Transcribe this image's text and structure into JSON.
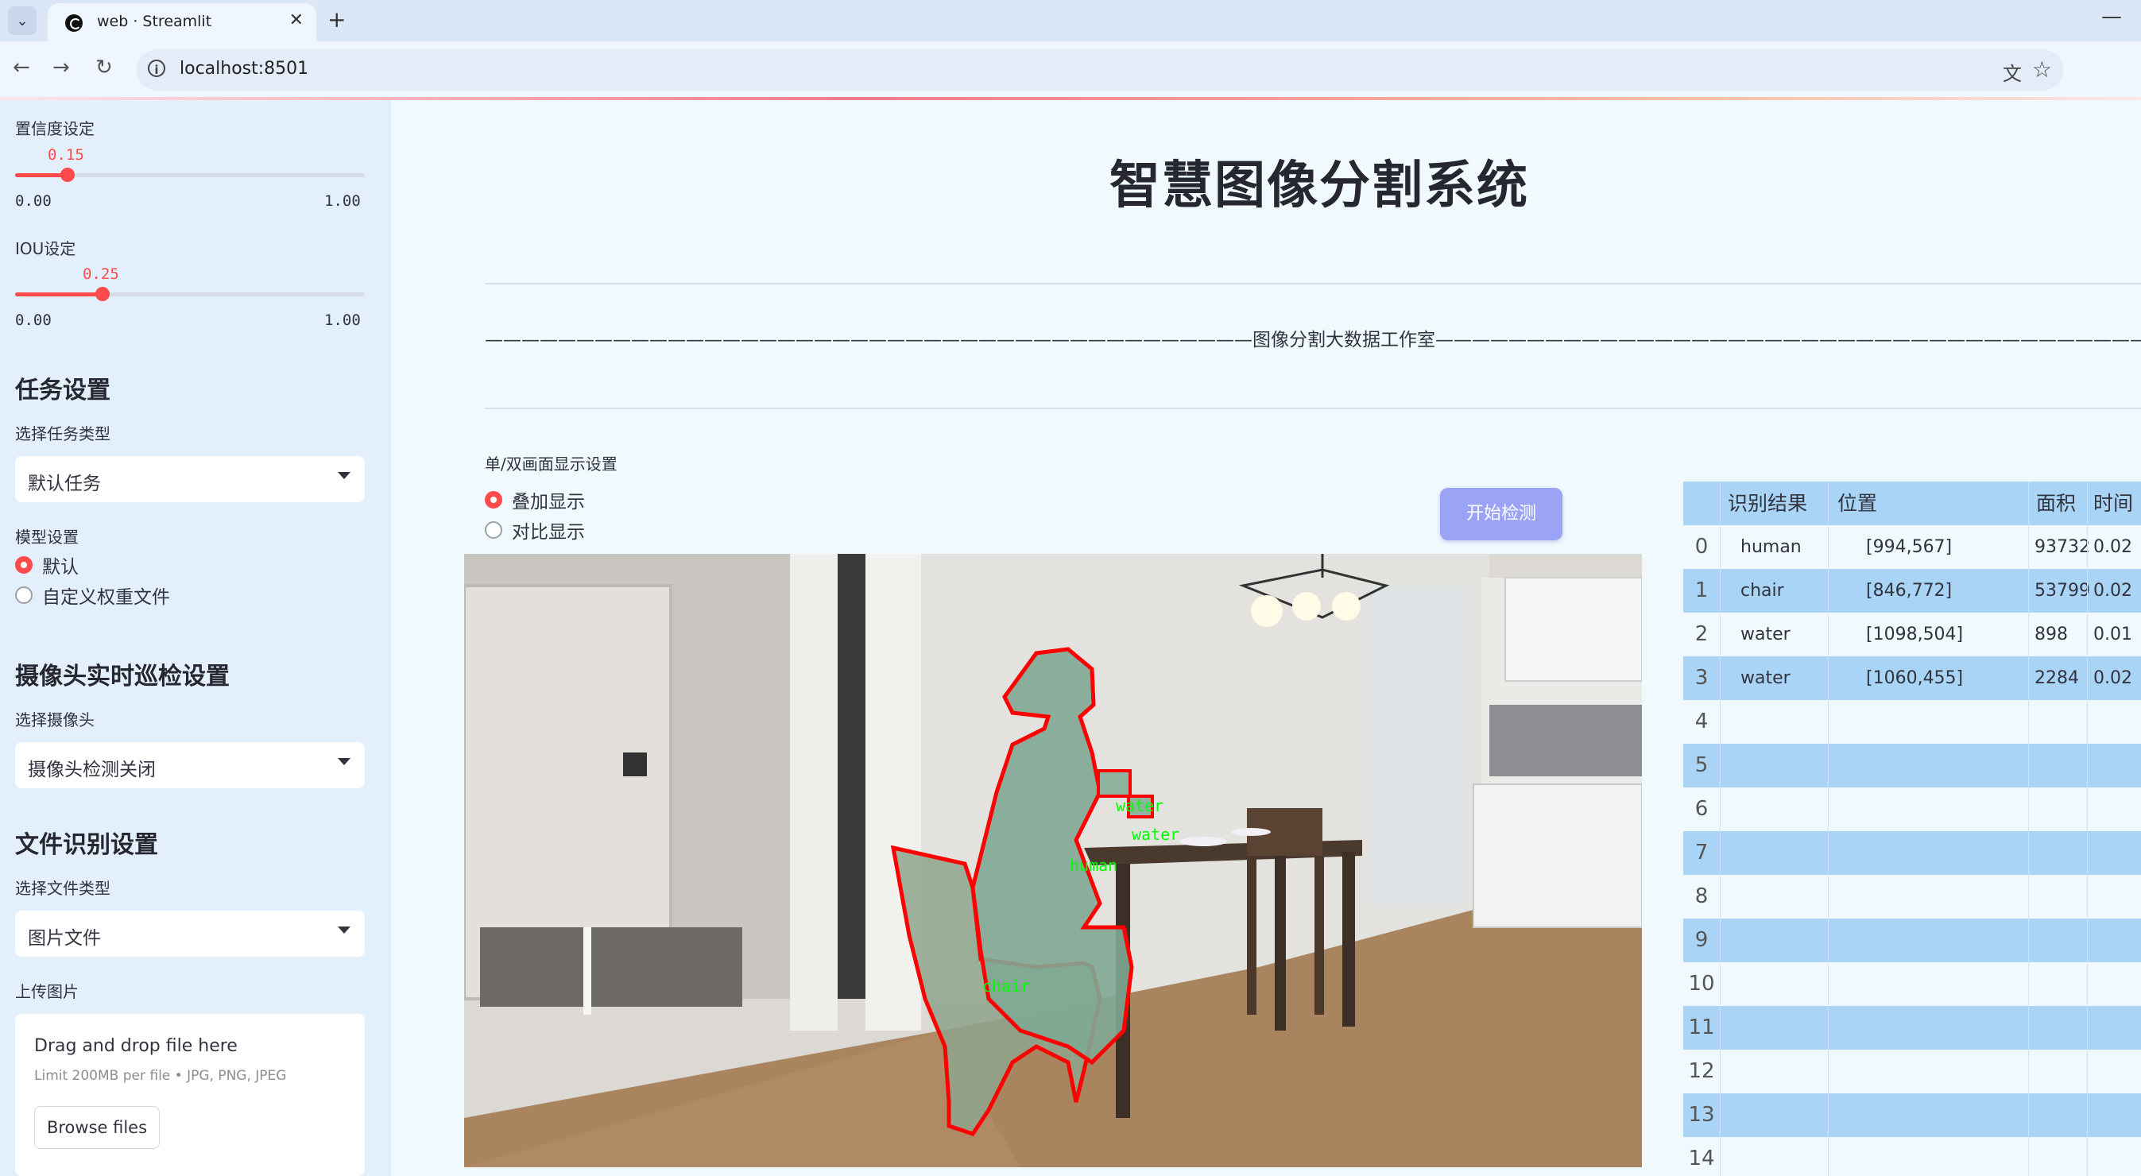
{
  "browser": {
    "tab_title": "web · Streamlit",
    "url": "localhost:8501"
  },
  "sidebar": {
    "confidence": {
      "label": "置信度设定",
      "value": "0.15",
      "value_num": 0.15,
      "min": "0.00",
      "max": "1.00"
    },
    "iou": {
      "label": "IOU设定",
      "value": "0.25",
      "value_num": 0.25,
      "min": "0.00",
      "max": "1.00"
    },
    "task_heading": "任务设置",
    "task_type_label": "选择任务类型",
    "task_type_value": "默认任务",
    "model_label": "模型设置",
    "model_options": [
      "默认",
      "自定义权重文件"
    ],
    "model_selected": 0,
    "camera_heading": "摄像头实时巡检设置",
    "camera_label": "选择摄像头",
    "camera_value": "摄像头检测关闭",
    "file_heading": "文件识别设置",
    "file_type_label": "选择文件类型",
    "file_type_value": "图片文件",
    "upload_label": "上传图片",
    "upload_title": "Drag and drop file here",
    "upload_limit": "Limit 200MB per file • JPG, PNG, JPEG",
    "browse_button": "Browse files"
  },
  "main": {
    "title": "智慧图像分割系统",
    "subtitle_line": "——————————————————————————————————————————图像分割大数据工作室————————————————————————————————————————————",
    "display_label": "单/双画面显示设置",
    "display_options": [
      "叠加显示",
      "对比显示"
    ],
    "display_selected": 0,
    "start_button": "开始检测"
  },
  "detections": [
    {
      "label": "human",
      "color": "#00ff00"
    },
    {
      "label": "water",
      "color": "#00ff00"
    },
    {
      "label": "water",
      "color": "#00ff00"
    },
    {
      "label": "chair",
      "color": "#00ff00"
    }
  ],
  "results_table": {
    "columns": [
      "",
      "识别结果",
      "位置",
      "面积",
      "时间"
    ],
    "rows": [
      {
        "index": "0",
        "result": "human",
        "position": "[994,567]",
        "area": "93732",
        "time": "0.02"
      },
      {
        "index": "1",
        "result": "chair",
        "position": "[846,772]",
        "area": "53799",
        "time": "0.02"
      },
      {
        "index": "2",
        "result": "water",
        "position": "[1098,504]",
        "area": "898",
        "time": "0.01"
      },
      {
        "index": "3",
        "result": "water",
        "position": "[1060,455]",
        "area": "2284",
        "time": "0.02"
      },
      {
        "index": "4",
        "result": "",
        "position": "",
        "area": "",
        "time": ""
      },
      {
        "index": "5",
        "result": "",
        "position": "",
        "area": "",
        "time": ""
      },
      {
        "index": "6",
        "result": "",
        "position": "",
        "area": "",
        "time": ""
      },
      {
        "index": "7",
        "result": "",
        "position": "",
        "area": "",
        "time": ""
      },
      {
        "index": "8",
        "result": "",
        "position": "",
        "area": "",
        "time": ""
      },
      {
        "index": "9",
        "result": "",
        "position": "",
        "area": "",
        "time": ""
      },
      {
        "index": "10",
        "result": "",
        "position": "",
        "area": "",
        "time": ""
      },
      {
        "index": "11",
        "result": "",
        "position": "",
        "area": "",
        "time": ""
      },
      {
        "index": "12",
        "result": "",
        "position": "",
        "area": "",
        "time": ""
      },
      {
        "index": "13",
        "result": "",
        "position": "",
        "area": "",
        "time": ""
      },
      {
        "index": "14",
        "result": "",
        "position": "",
        "area": "",
        "time": ""
      }
    ]
  },
  "colors": {
    "accent": "#ff4b4b",
    "sidebar_bg": "#e3f0fb",
    "main_bg": "#f0fafe",
    "table_header": "#a9d4f5",
    "table_stripe": "#a9d4f5",
    "mask_outline": "#ff0000"
  }
}
